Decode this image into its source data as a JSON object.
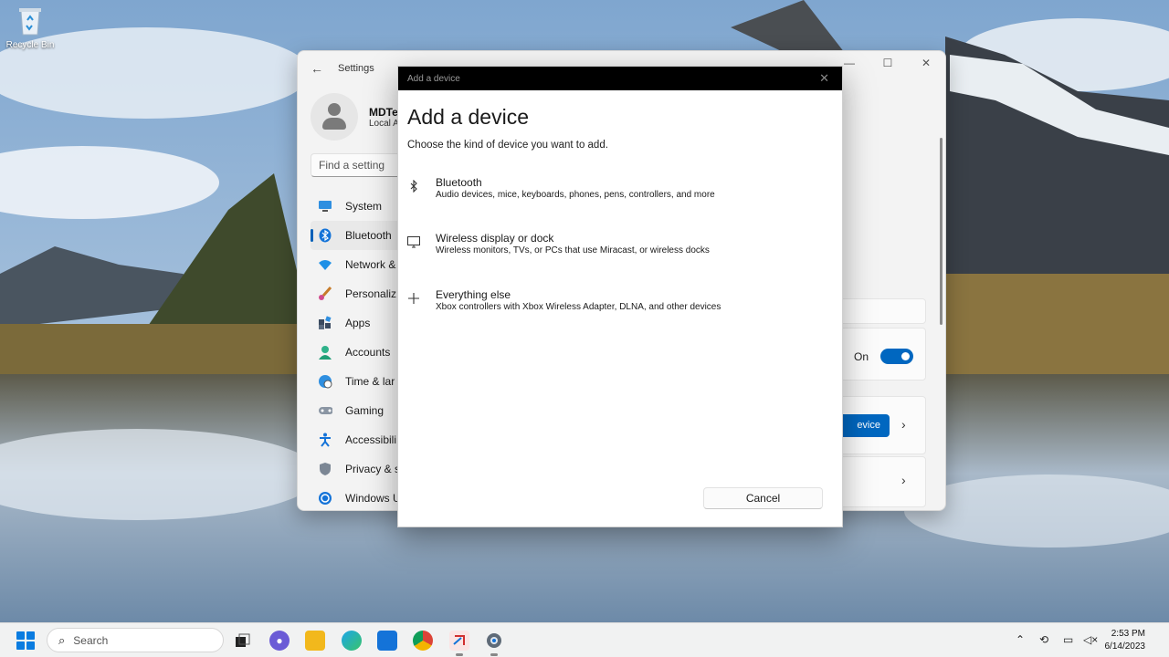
{
  "desktop": {
    "recycle_bin_label": "Recycle Bin"
  },
  "settings": {
    "title": "Settings",
    "user_name": "MDTe",
    "account_type": "Local A",
    "search_placeholder": "Find a setting",
    "nav": [
      {
        "label": "System",
        "icon": "monitor-icon"
      },
      {
        "label": "Bluetooth",
        "icon": "bluetooth-icon"
      },
      {
        "label": "Network &",
        "icon": "wifi-icon"
      },
      {
        "label": "Personaliz",
        "icon": "brush-icon"
      },
      {
        "label": "Apps",
        "icon": "apps-icon"
      },
      {
        "label": "Accounts",
        "icon": "person-icon"
      },
      {
        "label": "Time & lar",
        "icon": "globe-icon"
      },
      {
        "label": "Gaming",
        "icon": "controller-icon"
      },
      {
        "label": "Accessibili",
        "icon": "accessibility-icon"
      },
      {
        "label": "Privacy & s",
        "icon": "shield-icon"
      },
      {
        "label": "Windows U",
        "icon": "update-icon"
      }
    ],
    "toggle_label": "On",
    "toggle_state": true,
    "add_device_button_fragment": "evice"
  },
  "dialog": {
    "window_title": "Add a device",
    "heading": "Add a device",
    "subtitle": "Choose the kind of device you want to add.",
    "options": [
      {
        "title": "Bluetooth",
        "description": "Audio devices, mice, keyboards, phones, pens, controllers, and more",
        "icon": "bluetooth-icon"
      },
      {
        "title": "Wireless display or dock",
        "description": "Wireless monitors, TVs, or PCs that use Miracast, or wireless docks",
        "icon": "display-icon"
      },
      {
        "title": "Everything else",
        "description": "Xbox controllers with Xbox Wireless Adapter, DLNA, and other devices",
        "icon": "plus-icon"
      }
    ],
    "cancel_label": "Cancel"
  },
  "taskbar": {
    "search_placeholder": "Search",
    "time": "2:53 PM",
    "date": "6/14/2023"
  },
  "colors": {
    "accent": "#0067c0",
    "dialog_titlebar": "#000000"
  }
}
